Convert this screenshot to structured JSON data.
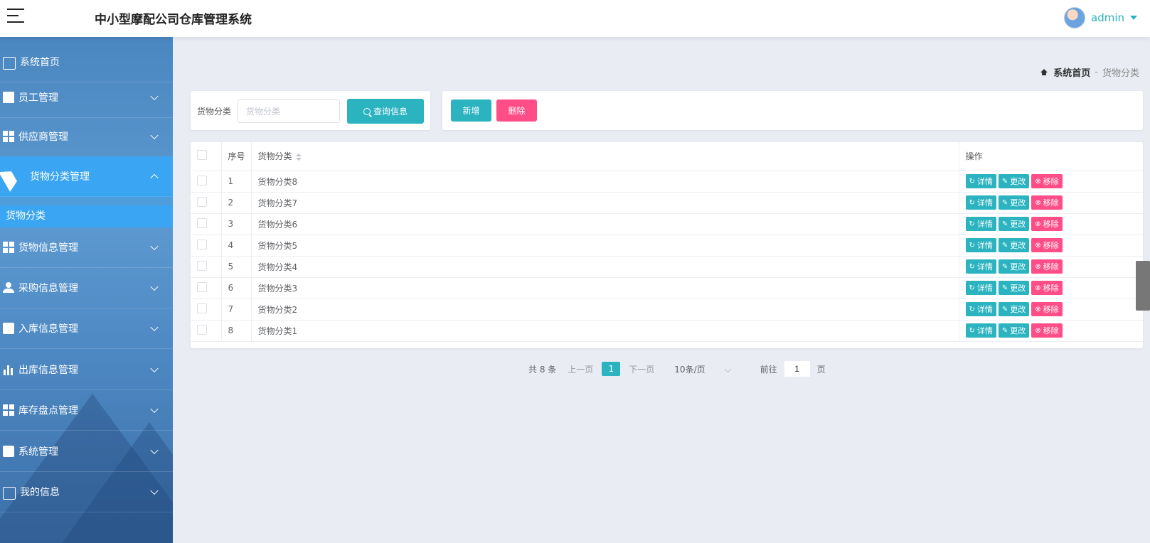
{
  "header": {
    "title": "中小型摩配公司仓库管理系统",
    "user": "admin"
  },
  "sidebar": {
    "items": [
      {
        "label": "系统首页"
      },
      {
        "label": "员工管理"
      },
      {
        "label": "供应商管理"
      },
      {
        "label": "货物分类管理"
      },
      {
        "label": "货物信息管理"
      },
      {
        "label": "采购信息管理"
      },
      {
        "label": "入库信息管理"
      },
      {
        "label": "出库信息管理"
      },
      {
        "label": "库存盘点管理"
      },
      {
        "label": "系统管理"
      },
      {
        "label": "我的信息"
      }
    ],
    "active_sub": "货物分类"
  },
  "breadcrumb": {
    "home": "系统首页",
    "sep": "-",
    "current": "货物分类"
  },
  "search": {
    "label": "货物分类",
    "placeholder": "货物分类",
    "button": "查询信息"
  },
  "actions": {
    "add": "新增",
    "delete": "删除"
  },
  "table": {
    "headers": {
      "index": "序号",
      "category": "货物分类",
      "ops": "操作"
    },
    "rows": [
      {
        "index": "1",
        "category": "货物分类8"
      },
      {
        "index": "2",
        "category": "货物分类7"
      },
      {
        "index": "3",
        "category": "货物分类6"
      },
      {
        "index": "4",
        "category": "货物分类5"
      },
      {
        "index": "5",
        "category": "货物分类4"
      },
      {
        "index": "6",
        "category": "货物分类3"
      },
      {
        "index": "7",
        "category": "货物分类2"
      },
      {
        "index": "8",
        "category": "货物分类1"
      }
    ],
    "ops": {
      "detail": "详情",
      "edit": "更改",
      "remove": "移除"
    }
  },
  "pager": {
    "total": "共 8 条",
    "prev": "上一页",
    "current": "1",
    "next": "下一页",
    "size": "10条/页",
    "goto": "前往",
    "page_value": "1",
    "page_suffix": "页"
  },
  "colors": {
    "primary": "#2bb3c0",
    "danger": "#ff4d87",
    "menu_active": "#3aa5f2"
  }
}
